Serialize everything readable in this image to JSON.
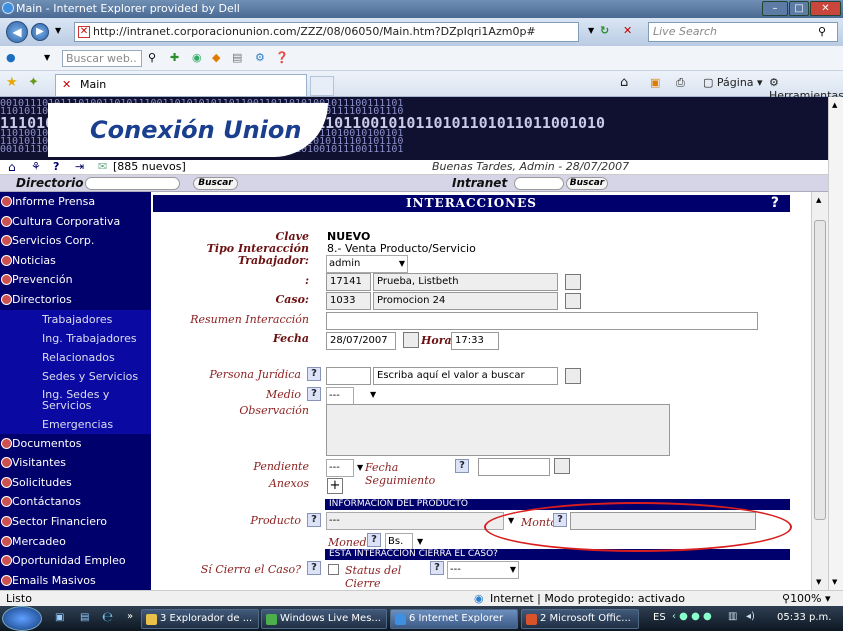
{
  "window": {
    "title": "Main - Internet Explorer provided by Dell"
  },
  "addressbar": {
    "url": "http://intranet.corporacionunion.com/ZZZ/08/06050/Main.htm?DZpIqri1Azm0p#",
    "search_placeholder": "Live Search"
  },
  "linksbar": {
    "search_placeholder": "Buscar web.."
  },
  "tabs": [
    {
      "label": "Main"
    }
  ],
  "commandbar": {
    "page_label": "Página",
    "tools_label": "Herramientas"
  },
  "site": {
    "logo_text": "Conexión Union",
    "banner_line1": "0010111010111010011010111001101010101101100110110101001011100111101",
    "banner_line2": "1101011010111110111101111101000011101101101100110011010111101101110",
    "banner_big": "1110101011101101010110111011001110011011001010110101101011011001010",
    "banner_line4": "1101001010100101011010110110101001011110010101010001011010010100101",
    "new_messages": "[885 nuevos]",
    "welcome": "Buenas Tardes, Admin - 28/07/2007"
  },
  "searchbar": {
    "directorio_label": "Directorio",
    "intranet_label": "Intranet",
    "buscar_label": "Buscar"
  },
  "sidebar": {
    "items": [
      {
        "label": "Informe Prensa"
      },
      {
        "label": "Cultura Corporativa"
      },
      {
        "label": "Servicios Corp."
      },
      {
        "label": "Noticias"
      },
      {
        "label": "Prevención"
      },
      {
        "label": "Directorios"
      }
    ],
    "subitems": [
      {
        "label": "Trabajadores"
      },
      {
        "label": "Ing. Trabajadores"
      },
      {
        "label": "Relacionados"
      },
      {
        "label": "Sedes y Servicios"
      },
      {
        "label": "Ing. Sedes y Servicios"
      },
      {
        "label": "Emergencias"
      }
    ],
    "items2": [
      {
        "label": "Documentos"
      },
      {
        "label": "Visitantes"
      },
      {
        "label": "Solicitudes"
      },
      {
        "label": "Contáctanos"
      },
      {
        "label": "Sector Financiero"
      },
      {
        "label": "Mercadeo"
      },
      {
        "label": "Oportunidad Empleo"
      },
      {
        "label": "Emails Masivos"
      }
    ]
  },
  "form": {
    "header": "INTERACCIONES",
    "help": "?",
    "clave_label": "Clave",
    "clave_value": "NUEVO",
    "tipo_label": "Tipo Interacción",
    "tipo_value": "8.- Venta Producto/Servicio",
    "trabajador_label": "Trabajador:",
    "trabajador_value": "admin",
    "colon_label": ":",
    "persona_code": "17141",
    "persona_name": "Prueba, Listbeth",
    "caso_label": "Caso:",
    "caso_code": "1033",
    "caso_name": "Promocion 24",
    "resumen_label": "Resumen Interacción",
    "fecha_label": "Fecha",
    "fecha_value": "28/07/2007",
    "hora_label": "Hora",
    "hora_value": "17:33",
    "pj_label": "Persona Jurídica",
    "pj_placeholder": "Escriba aquí el valor a buscar",
    "medio_label": "Medio",
    "medio_value": "---",
    "observacion_label": "Observación",
    "pendiente_label": "Pendiente",
    "pendiente_value": "---",
    "fecha_seg_label": "Fecha Seguimiento",
    "anexos_label": "Anexos",
    "info_producto_header": "INFORMACION DEL PRODUCTO",
    "producto_label": "Producto",
    "producto_value": "---",
    "monto_label": "Monto",
    "moneda_label": "Moneda",
    "moneda_value": "Bs.",
    "cierre_header": "ESTA INTERACCION CIERRA EL CASO?",
    "cierre_label": "Sí Cierra el Caso?",
    "status_cierre_label": "Status del Cierre",
    "status_cierre_value": "---"
  },
  "statusbar": {
    "left": "Listo",
    "zone": "Internet | Modo protegido: activado",
    "zoom": "100%"
  },
  "taskbar": {
    "tasks": [
      {
        "label": "3 Explorador de ..."
      },
      {
        "label": "Windows Live Mes..."
      },
      {
        "label": "6 Internet Explorer"
      },
      {
        "label": "2 Microsoft Offic..."
      }
    ],
    "lang": "ES",
    "clock": "05:33 p.m."
  }
}
